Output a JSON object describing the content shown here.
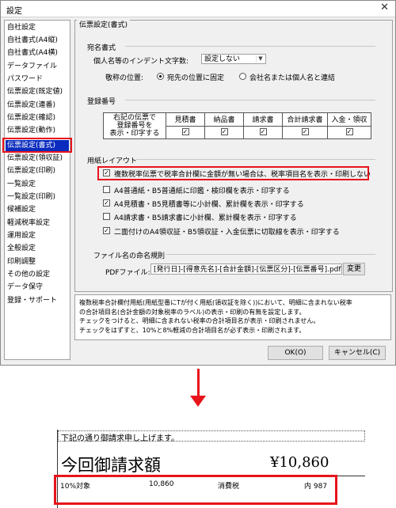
{
  "window": {
    "title": "設定"
  },
  "sidebar": {
    "items": [
      "自社設定",
      "自社書式(A4縦)",
      "自社書式(A4横)",
      "データファイル",
      "パスワード",
      "伝票設定(既定値)",
      "伝票設定(連番)",
      "伝票設定(確認)",
      "伝票設定(動作)",
      "伝票設定(書式)",
      "伝票設定(領収証)",
      "伝票設定(印刷)",
      "一覧設定",
      "一覧設定(印刷)",
      "候補設定",
      "軽減税率設定",
      "運用設定",
      "全般設定",
      "印刷調整",
      "その他の設定",
      "データ保守",
      "登録・サポート"
    ],
    "selected": "伝票設定(書式)"
  },
  "panel": {
    "title": "伝票設定(書式)",
    "address": {
      "label": "宛名書式",
      "indent_label": "個人名等のインデント文字数:",
      "indent_value": "設定しない",
      "honorific_label": "敬称の位置:",
      "option_fixed": "宛先の位置に固定",
      "option_linked": "会社名または個人名と連結",
      "selected": "宛先の位置に固定"
    },
    "registration": {
      "label": "登録番号",
      "row_header_lines": [
        "右記の伝票で",
        "登録番号を",
        "表示・印字する"
      ],
      "columns": [
        "見積書",
        "納品書",
        "請求書",
        "合計請求書",
        "入金・領収"
      ],
      "checked": [
        true,
        true,
        true,
        true,
        true
      ]
    },
    "paper": {
      "label": "用紙レイアウト",
      "options": [
        {
          "label": "複数税率伝票で税率合計欄に金額が無い場合は、税率項目名を表示・印刷しない",
          "checked": true
        },
        {
          "label": "A4普通紙・B5普通紙に印鑑・検印欄を表示・印字する",
          "checked": false
        },
        {
          "label": "A4見積書・B5見積書等に小計欄、累計欄を表示・印字する",
          "checked": true
        },
        {
          "label": "A4請求書・B5請求書に小計欄、累計欄を表示・印字する",
          "checked": false
        },
        {
          "label": "二面付けのA4領収証・B5領収証・入金伝票に切取線を表示・印字する",
          "checked": true
        }
      ]
    },
    "filename": {
      "label": "ファイル名の命名規則",
      "pdf_label": "PDFファイル:",
      "pdf_value": "[発行日]-[得意先名]-[合計金額]-[伝票区分]-[伝票番号].pdf",
      "change_button": "変更"
    }
  },
  "info": {
    "lines": [
      "複数税率合計欄付用紙(用紙型番にTが付く用紙(領収証を除く))において、明細に含まれない税率",
      "の合計項目名(合計金額の対象税率のラベル)の表示・印刷の有無を設定します。",
      "チェックをつけると、明細に含まれない税率の合計項目名が表示・印刷されません。",
      "チェックをはずすと、10%と8%軽減の合計項目名が必ず表示・印刷されます。"
    ]
  },
  "buttons": {
    "ok": "OK(O)",
    "cancel": "キャンセル(C)"
  },
  "preview": {
    "heading": "下記の通り御請求申し上げます。",
    "title": "今回御請求額",
    "amount": "¥10,860",
    "row": {
      "target": "10%対象",
      "value": "10,860",
      "tax_label": "消費税",
      "tax_value": "内 987"
    }
  },
  "colors": {
    "highlight": "#e8141b",
    "selection": "#0a2bbd"
  }
}
